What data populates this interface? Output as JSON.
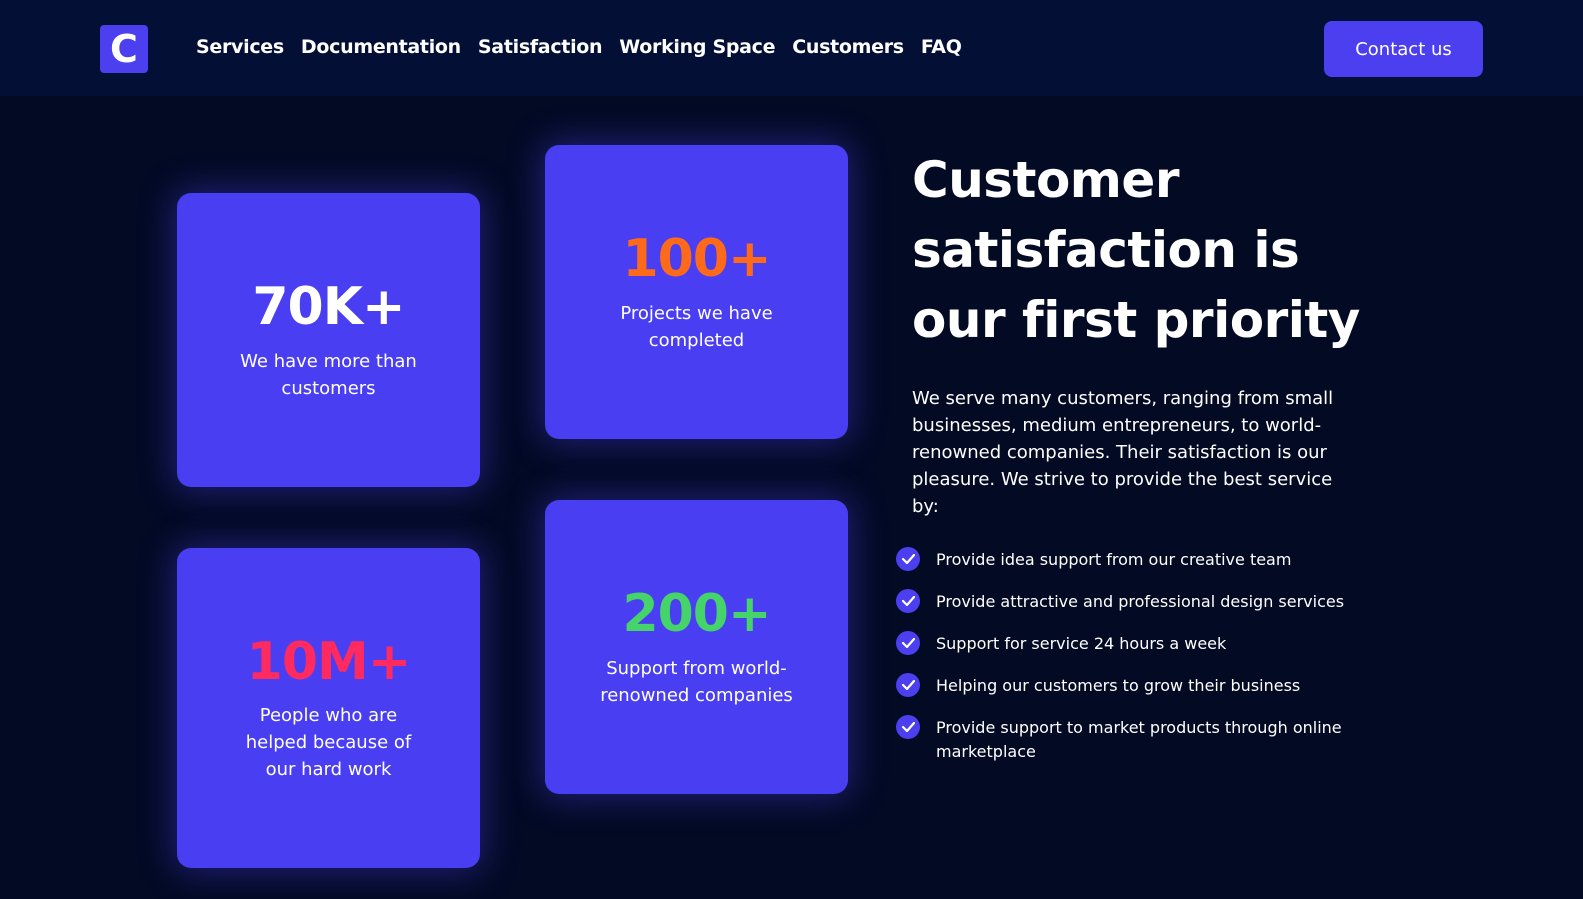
{
  "brand": {
    "logo_letter": "C",
    "accent": "#4b3ff0"
  },
  "nav": {
    "items": [
      {
        "label": "Services"
      },
      {
        "label": "Documentation"
      },
      {
        "label": "Satisfaction"
      },
      {
        "label": "Working Space"
      },
      {
        "label": "Customers"
      },
      {
        "label": "FAQ"
      }
    ],
    "contact_label": "Contact us"
  },
  "stats": [
    {
      "value": "70K+",
      "description": "We have more than customers",
      "color": "#ffffff"
    },
    {
      "value": "100+",
      "description": "Projects we have completed",
      "color": "#ff6a1a"
    },
    {
      "value": "10M+",
      "description": "People who are helped because of our hard work",
      "color": "#ff2a5f"
    },
    {
      "value": "200+",
      "description": "Support from world-renowned companies",
      "color": "#45d46a"
    }
  ],
  "section": {
    "title": "Customer satisfaction is our first priority",
    "paragraph": "We serve many customers, ranging from small businesses, medium entrepreneurs, to world-renowned companies. Their satisfaction is our pleasure. We strive to provide the best service by:",
    "features": [
      "Provide idea support from our creative team",
      "Provide attractive and professional design services",
      "Support for service 24 hours a week",
      "Helping our customers to grow their business",
      "Provide support to market products through online marketplace"
    ],
    "check_icon": "check-circle-icon"
  }
}
